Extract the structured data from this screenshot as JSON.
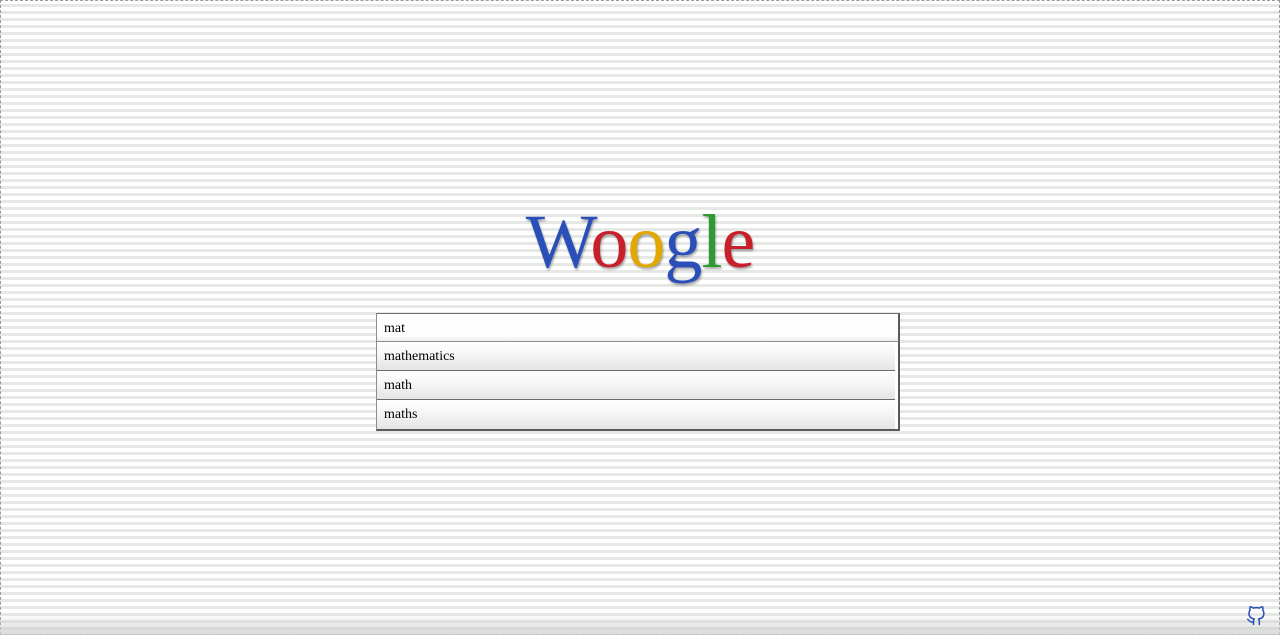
{
  "logo": {
    "letters": [
      {
        "char": "W",
        "color": "#2a4fb8"
      },
      {
        "char": "o",
        "color": "#c8202a"
      },
      {
        "char": "o",
        "color": "#e0a800"
      },
      {
        "char": "g",
        "color": "#2a4fb8"
      },
      {
        "char": "l",
        "color": "#2f9a2f"
      },
      {
        "char": "e",
        "color": "#c8202a"
      }
    ]
  },
  "search": {
    "value": "mat",
    "suggestions": [
      "mathematics",
      "math",
      "maths"
    ]
  },
  "footer": {
    "github_icon": "github-icon",
    "github_color": "#2a4fb8"
  }
}
